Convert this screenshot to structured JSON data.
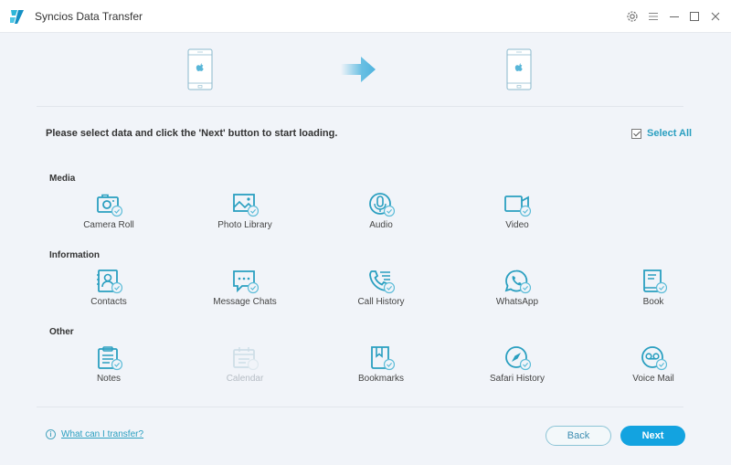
{
  "window": {
    "title": "Syncios Data Transfer",
    "controls": [
      "settings-icon",
      "menu-icon",
      "minimize-icon",
      "maximize-icon",
      "close-icon"
    ]
  },
  "header": {
    "source_device": "iOS device",
    "target_device": "iOS device",
    "transfer_arrow": "arrow-right-icon"
  },
  "instruction": "Please select data and click the 'Next' button to start loading.",
  "select_all": {
    "label": "Select All",
    "checked": true
  },
  "sections": [
    {
      "label": "Media",
      "items": [
        {
          "label": "Camera Roll",
          "icon": "camera-icon",
          "checked": true,
          "enabled": true
        },
        {
          "label": "Photo Library",
          "icon": "photo-icon",
          "checked": true,
          "enabled": true
        },
        {
          "label": "Audio",
          "icon": "microphone-icon",
          "checked": true,
          "enabled": true
        },
        {
          "label": "Video",
          "icon": "video-icon",
          "checked": true,
          "enabled": true
        }
      ]
    },
    {
      "label": "Information",
      "items": [
        {
          "label": "Contacts",
          "icon": "contacts-icon",
          "checked": true,
          "enabled": true
        },
        {
          "label": "Message Chats",
          "icon": "message-icon",
          "checked": true,
          "enabled": true
        },
        {
          "label": "Call History",
          "icon": "phone-icon",
          "checked": true,
          "enabled": true
        },
        {
          "label": "WhatsApp",
          "icon": "whatsapp-icon",
          "checked": true,
          "enabled": true
        },
        {
          "label": "Book",
          "icon": "book-icon",
          "checked": true,
          "enabled": true
        }
      ]
    },
    {
      "label": "Other",
      "items": [
        {
          "label": "Notes",
          "icon": "notes-icon",
          "checked": true,
          "enabled": true
        },
        {
          "label": "Calendar",
          "icon": "calendar-icon",
          "checked": false,
          "enabled": false
        },
        {
          "label": "Bookmarks",
          "icon": "bookmark-icon",
          "checked": true,
          "enabled": true
        },
        {
          "label": "Safari History",
          "icon": "compass-icon",
          "checked": true,
          "enabled": true
        },
        {
          "label": "Voice Mail",
          "icon": "voicemail-icon",
          "checked": true,
          "enabled": true
        }
      ]
    }
  ],
  "footer": {
    "help_link": "What can I transfer?",
    "back_label": "Back",
    "next_label": "Next"
  },
  "colors": {
    "accent": "#13a3e0",
    "icon": "#2a9fc0",
    "background": "#f1f4f9"
  }
}
